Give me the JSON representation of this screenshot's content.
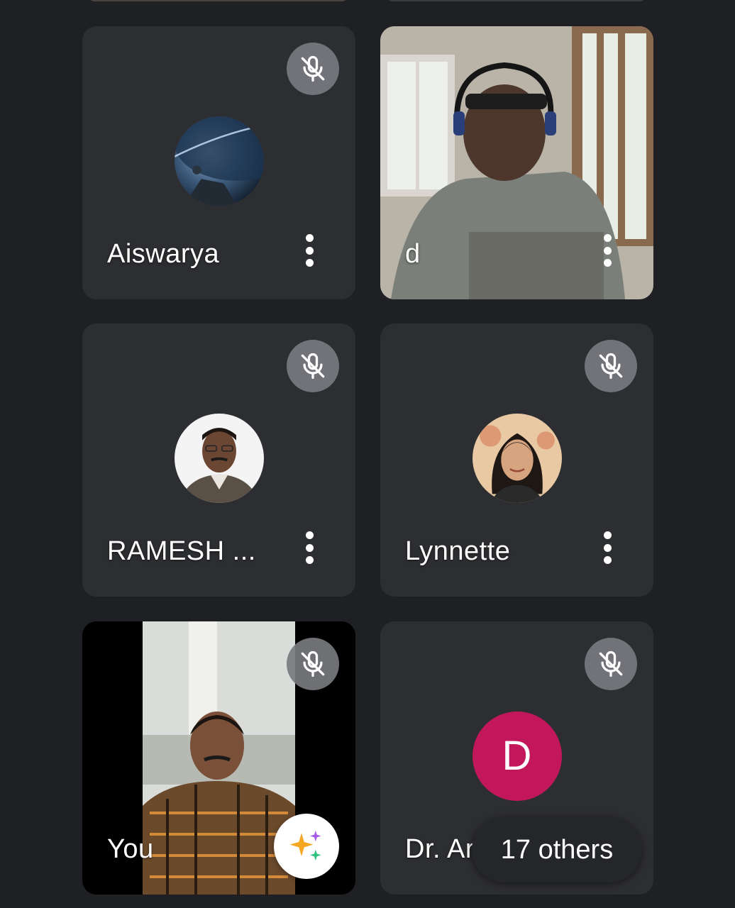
{
  "participants": [
    {
      "name": "Aiswarya",
      "muted": true,
      "avatar": "planet-avatar"
    },
    {
      "name": "d",
      "muted": false,
      "avatar": "camera-video"
    },
    {
      "name": "RAMESH ...",
      "muted": true,
      "avatar": "photo-avatar"
    },
    {
      "name": "Lynnette",
      "muted": true,
      "avatar": "photo-avatar"
    },
    {
      "name": "You",
      "muted": true,
      "avatar": "self-camera-video"
    },
    {
      "name": "Dr. Arun",
      "muted": true,
      "avatar_letter": "D"
    }
  ],
  "others": {
    "label": "17 others"
  },
  "colors": {
    "background": "#1f2023",
    "tile": "#2d2e31",
    "mute_button": "#7a7c80",
    "letter_avatar": "#c2185b"
  },
  "icons": [
    "mic-off-icon",
    "more-vert-icon",
    "sparkle-effects-icon"
  ]
}
